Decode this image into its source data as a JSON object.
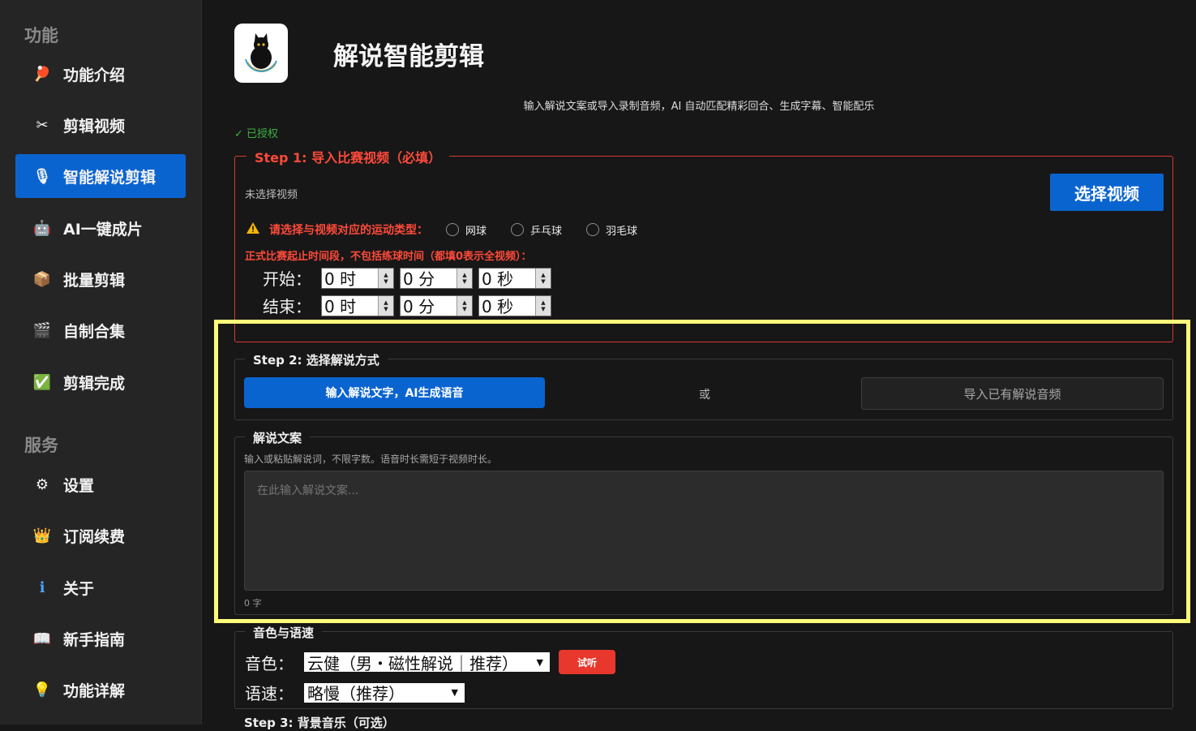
{
  "sidebar": {
    "section_features": "功能",
    "section_services": "服务",
    "features": [
      {
        "label": "功能介绍",
        "icon": "ping-pong-paddle-icon",
        "glyph": "🏓"
      },
      {
        "label": "剪辑视频",
        "icon": "scissors-icon",
        "glyph": "✂"
      },
      {
        "label": "智能解说剪辑",
        "icon": "microphone-icon",
        "glyph": "🎙"
      },
      {
        "label": "AI一键成片",
        "icon": "robot-icon",
        "glyph": "🤖"
      },
      {
        "label": "批量剪辑",
        "icon": "package-icon",
        "glyph": "📦"
      },
      {
        "label": "自制合集",
        "icon": "clapperboard-icon",
        "glyph": "🎬"
      },
      {
        "label": "剪辑完成",
        "icon": "check-box-icon",
        "glyph": "✅"
      }
    ],
    "services": [
      {
        "label": "设置",
        "icon": "gear-icon",
        "glyph": "⚙"
      },
      {
        "label": "订阅续费",
        "icon": "crown-icon",
        "glyph": "👑"
      },
      {
        "label": "关于",
        "icon": "info-icon",
        "glyph": "ℹ"
      },
      {
        "label": "新手指南",
        "icon": "book-icon",
        "glyph": "📖"
      },
      {
        "label": "功能详解",
        "icon": "light-bulb-icon",
        "glyph": "💡"
      }
    ],
    "active_index": 2
  },
  "header": {
    "title": "解说智能剪辑",
    "subtitle": "输入解说文案或导入录制音频，AI 自动匹配精彩回合、生成字幕、智能配乐",
    "auth_status": "✓ 已授权"
  },
  "step1": {
    "legend": "Step 1: 导入比赛视频（必填）",
    "no_video": "未选择视频",
    "choose_button": "选择视频",
    "warning": "请选择与视频对应的运动类型：",
    "sports": [
      "网球",
      "乒乓球",
      "羽毛球"
    ],
    "period_note": "正式比赛起止时间段，不包括练球时间（都填0表示全视频）：",
    "start_label": "开始：",
    "end_label": "结束：",
    "start": [
      "0 时",
      "0 分",
      "0 秒"
    ],
    "end": [
      "0 时",
      "0 分",
      "0 秒"
    ]
  },
  "step2": {
    "legend": "Step 2: 选择解说方式",
    "mode_text": "输入解说文字，AI生成语音",
    "or": "或",
    "mode_audio": "导入已有解说音频"
  },
  "script": {
    "legend": "解说文案",
    "hint": "输入或粘贴解说词，不限字数。语音时长需短于视频时长。",
    "placeholder": "在此输入解说文案...",
    "count": "0 字"
  },
  "voice": {
    "legend": "音色与语速",
    "voice_label": "音色：",
    "voice_value": "云健（男・磁性解说｜推荐）",
    "listen_button": "试听",
    "speed_label": "语速：",
    "speed_value": "略慢（推荐）"
  },
  "step3_partial": "Step 3: 背景音乐（可选）",
  "colors": {
    "accent": "#0a64d0",
    "danger": "#ff4a3a",
    "success": "#3cb043",
    "highlight": "#fffc7a"
  }
}
